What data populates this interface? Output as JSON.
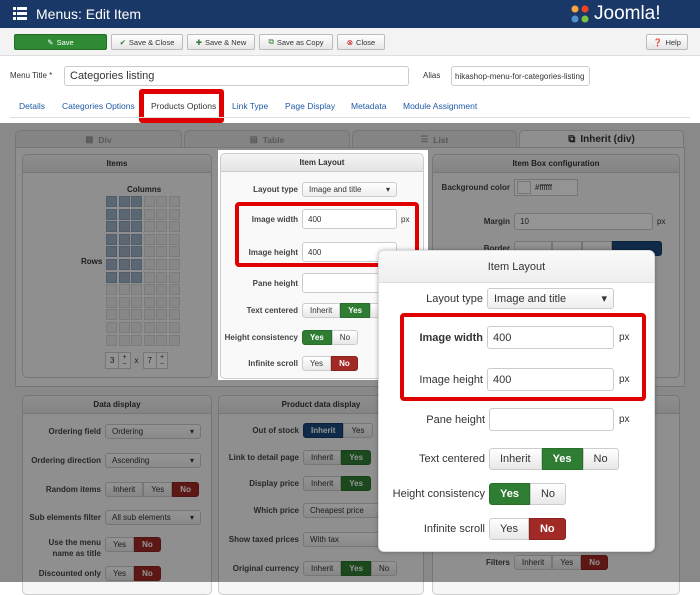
{
  "header": {
    "title": "Menus: Edit Item",
    "brand": "Joomla!"
  },
  "toolbar": {
    "save": "Save",
    "save_close": "Save & Close",
    "save_new": "Save & New",
    "save_copy": "Save as Copy",
    "close": "Close",
    "help": "Help"
  },
  "form": {
    "menu_title_label": "Menu Title *",
    "menu_title_value": "Categories listing",
    "alias_label": "Alias",
    "alias_value": "hikashop-menu-for-categories-listing"
  },
  "tabs": [
    "Details",
    "Categories Options",
    "Products Options",
    "Link Type",
    "Page Display",
    "Metadata",
    "Module Assignment"
  ],
  "active_tab": "Products Options",
  "layout_tabs": [
    "Div",
    "Table",
    "List",
    "Inherit (div)"
  ],
  "items_panel": {
    "title": "Items",
    "columns_label": "Columns",
    "rows_label": "Rows",
    "columns": 3,
    "rows": 7,
    "grid_cols": 6,
    "grid_rows": 12,
    "x": "x",
    "plus": "+",
    "minus": "−"
  },
  "item_layout": {
    "title": "Item Layout",
    "layout_type_label": "Layout type",
    "layout_type": "Image and title",
    "image_width_label": "Image width",
    "image_width": "400",
    "image_height_label": "Image height",
    "image_height": "400",
    "pane_height_label": "Pane height",
    "pane_height": "",
    "unit": "px",
    "text_centered_label": "Text centered",
    "text_centered": [
      "Inherit",
      "Yes",
      "No"
    ],
    "height_consistency_label": "Height consistency",
    "height_consistency": [
      "Yes",
      "No"
    ],
    "infinite_scroll_label": "Infinite scroll",
    "infinite_scroll": [
      "Yes",
      "No"
    ]
  },
  "item_box": {
    "title": "Item Box configuration",
    "bg_label": "Background color",
    "bg_value": "#ffffff",
    "margin_label": "Margin",
    "margin_value": "10",
    "border_label": "Border",
    "unit": "px"
  },
  "data_display": {
    "title": "Data display",
    "ordering_field_label": "Ordering field",
    "ordering_field": "Ordering",
    "ordering_dir_label": "Ordering direction",
    "ordering_dir": "Ascending",
    "random_label": "Random items",
    "random": [
      "Inherit",
      "Yes",
      "No"
    ],
    "sub_filter_label": "Sub elements filter",
    "sub_filter": "All sub elements",
    "menu_name_label_1": "Use the menu",
    "menu_name_label_2": "name as title",
    "menu_name": [
      "Yes",
      "No"
    ],
    "discounted_label": "Discounted only",
    "discounted": [
      "Yes",
      "No"
    ]
  },
  "product_display": {
    "title": "Product data display",
    "out_of_stock_label": "Out of stock",
    "out_of_stock": [
      "Inherit",
      "Yes"
    ],
    "link_label": "Link to detail page",
    "link": [
      "Inherit",
      "Yes"
    ],
    "display_price_label": "Display price",
    "display_price": [
      "Inherit",
      "Yes"
    ],
    "which_price_label": "Which price",
    "which_price": "Cheapest price",
    "taxed_label": "Show taxed prices",
    "taxed": "With tax",
    "currency_label": "Original currency",
    "currency": [
      "Inherit",
      "Yes",
      "No"
    ]
  },
  "filters": {
    "label": "Filters",
    "options": [
      "Inherit",
      "Yes",
      "No"
    ]
  },
  "colors": {
    "header": "#1a3867",
    "yes": "#2f7d32",
    "no": "#a12a26",
    "inherit": "#1c4a7e",
    "highlight": "#e00000"
  }
}
